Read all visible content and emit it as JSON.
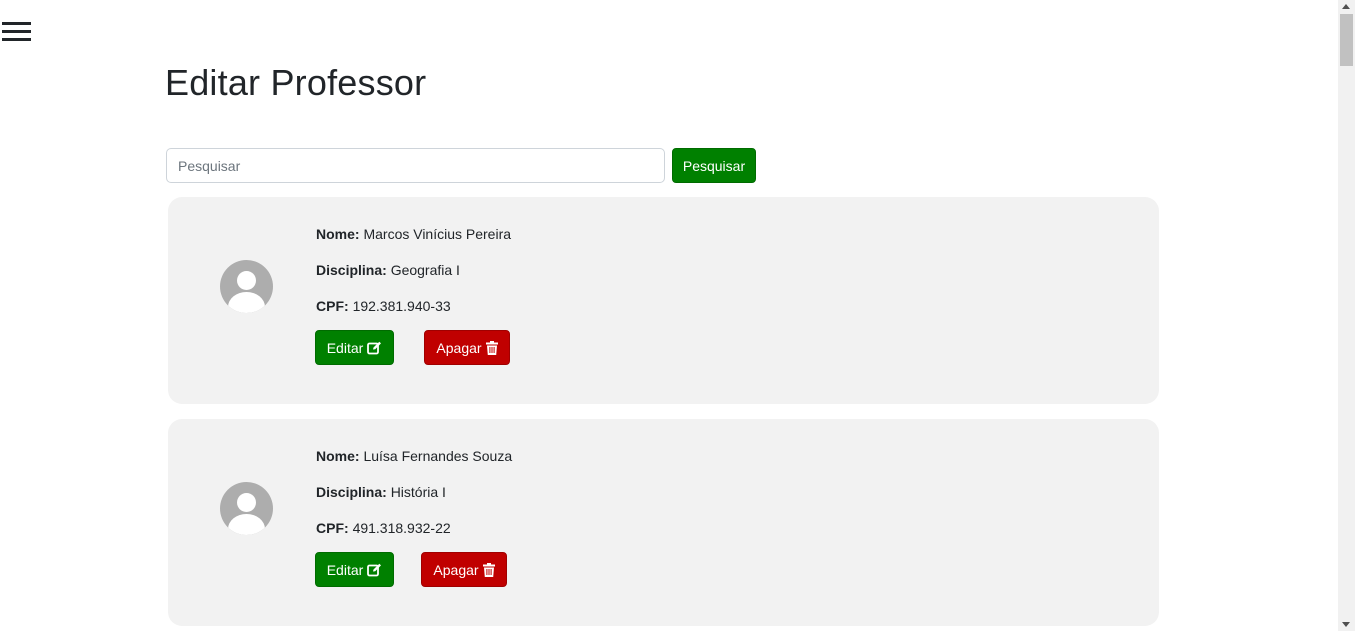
{
  "header": {
    "menu_icon": "hamburger-menu-icon",
    "title": "Editar Professor"
  },
  "search": {
    "placeholder": "Pesquisar",
    "value": "",
    "button_label": "Pesquisar"
  },
  "labels": {
    "nome": "Nome:",
    "disciplina": "Disciplina:",
    "cpf": "CPF:"
  },
  "professors": [
    {
      "nome": "Marcos Vinícius Pereira",
      "disciplina": "Geografia I",
      "cpf": "192.381.940-33",
      "edit_label": "Editar",
      "delete_label": "Apagar"
    },
    {
      "nome": "Luísa Fernandes Souza",
      "disciplina": "História I",
      "cpf": "491.318.932-22",
      "edit_label": "Editar",
      "delete_label": "Apagar"
    }
  ],
  "icons": {
    "avatar": "user-avatar-icon",
    "edit": "pencil-square-icon",
    "delete": "trash-icon"
  },
  "colors": {
    "primary_green": "#008000",
    "danger_red": "#c00000",
    "card_bg": "#f2f2f2"
  }
}
